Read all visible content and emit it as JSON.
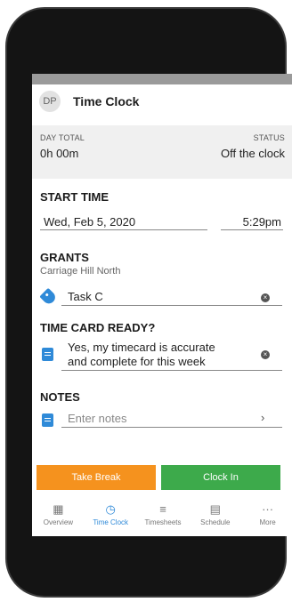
{
  "header": {
    "avatar_initials": "DP",
    "title": "Time Clock"
  },
  "summary": {
    "day_total_label": "DAY TOTAL",
    "day_total_value": "0h 00m",
    "status_label": "STATUS",
    "status_value": "Off the clock"
  },
  "start_time": {
    "label": "START TIME",
    "date": "Wed, Feb 5, 2020",
    "time": "5:29pm"
  },
  "grants": {
    "label": "GRANTS",
    "location": "Carriage Hill North",
    "task": "Task C",
    "task_icon": "tag-icon",
    "clear_icon": "clear-icon"
  },
  "time_card": {
    "label": "TIME CARD READY?",
    "line1": "Yes, my timecard is accurate",
    "line2": "and complete for this week"
  },
  "notes": {
    "label": "NOTES",
    "placeholder": "Enter notes",
    "chevron": "›"
  },
  "actions": {
    "break_label": "Take Break",
    "clock_in_label": "Clock In"
  },
  "nav": {
    "items": [
      {
        "label": "Overview",
        "icon": "overview-icon",
        "glyph": "▦"
      },
      {
        "label": "Time Clock",
        "icon": "clock-icon",
        "glyph": "◷"
      },
      {
        "label": "Timesheets",
        "icon": "timesheets-icon",
        "glyph": "≡"
      },
      {
        "label": "Schedule",
        "icon": "calendar-icon",
        "glyph": "▤"
      },
      {
        "label": "More",
        "icon": "more-icon",
        "glyph": "···"
      }
    ]
  },
  "colors": {
    "accent": "#2f8ad8",
    "break": "#f5921e",
    "clock_in": "#3daa4b"
  }
}
